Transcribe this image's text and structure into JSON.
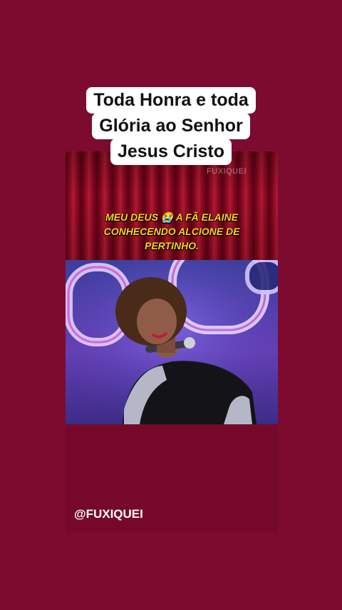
{
  "story": {
    "caption_lines": [
      "Toda Honra e toda",
      "Glória ao Senhor",
      "Jesus Cristo"
    ]
  },
  "post": {
    "watermark": "FUXIQUEI",
    "overlay_lines": [
      "MEU DEUS 😭 A FÃ ELAINE",
      "CONHECENDO ALCIONE DE",
      "PERTINHO."
    ],
    "handle": "@FUXIQUEI"
  },
  "colors": {
    "background": "#7d0b2f",
    "caption_bg": "#ffffff",
    "overlay_text": "#ffd21a"
  }
}
